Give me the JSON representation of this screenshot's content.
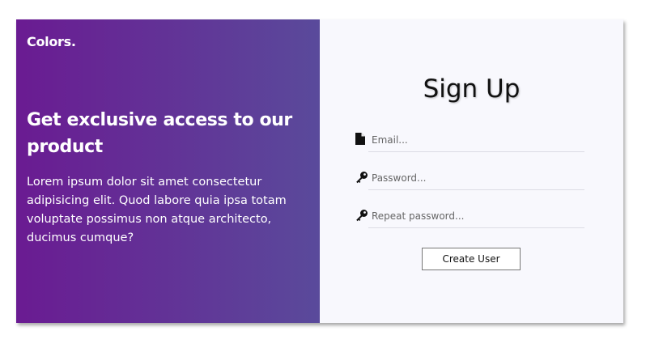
{
  "brand": "Colors.",
  "promo": {
    "headline": "Get exclusive access to our product",
    "body": "Lorem ipsum dolor sit amet consectetur adipisicing elit. Quod labore quia ipsa totam voluptate possimus non atque architecto, ducimus cumque?"
  },
  "signup": {
    "title": "Sign Up",
    "fields": [
      {
        "icon": "file-icon",
        "placeholder": "Email...",
        "value": ""
      },
      {
        "icon": "key-icon",
        "placeholder": "Password...",
        "value": ""
      },
      {
        "icon": "key-icon",
        "placeholder": "Repeat password...",
        "value": ""
      }
    ],
    "submit_label": "Create User"
  },
  "colors": {
    "gradient_start": "#6a1b92",
    "gradient_end": "#5a4a9b",
    "form_background": "#f8f8fd"
  }
}
